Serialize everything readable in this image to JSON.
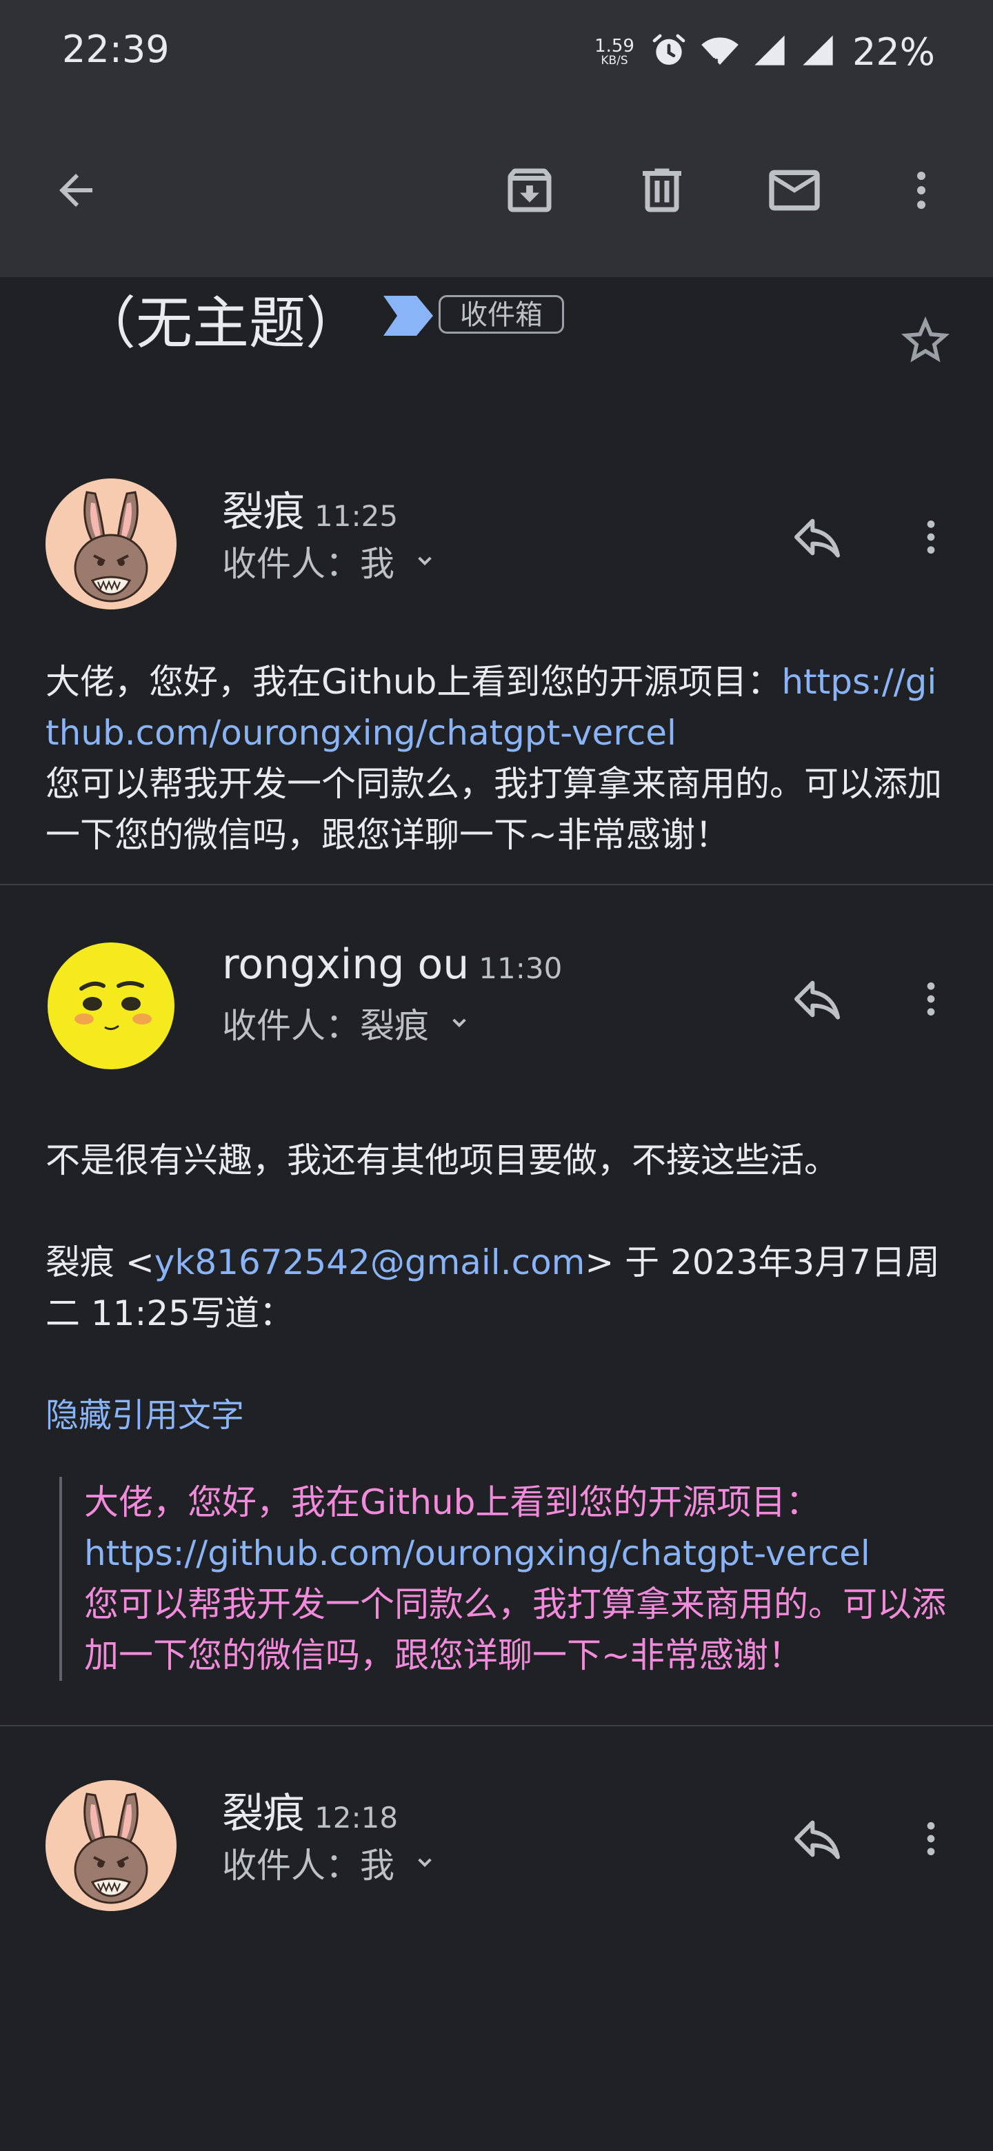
{
  "status": {
    "time": "22:39",
    "speed_value": "1.59",
    "speed_unit": "KB/S",
    "battery": "22%"
  },
  "toolbar": {
    "back": "back-arrow-icon",
    "archive": "archive-icon",
    "delete": "delete-icon",
    "mark_unread": "mail-icon",
    "more": "more-vert-icon"
  },
  "subject": {
    "title": "（无主题）",
    "label": "收件箱"
  },
  "messages": [
    {
      "sender": "裂痕",
      "time": "11:25",
      "recipient_prefix": "收件人：",
      "recipient": "我",
      "body_line1": "大佬，您好，我在Github上看到您的开源项目：",
      "body_link": "https://github.com/ourongxing/chatgpt-vercel",
      "body_line2": "您可以帮我开发一个同款么，我打算拿来商用的。可以添加一下您的微信吗，跟您详聊一下~非常感谢！"
    },
    {
      "sender": "rongxing ou",
      "time": "11:30",
      "recipient_prefix": "收件人：",
      "recipient": "裂痕",
      "body_line1": "不是很有兴趣，我还有其他项目要做，不接这些活。",
      "quote_author": "裂痕 <",
      "quote_email": "yk81672542@gmail.com",
      "quote_header_rest": "> 于 2023年3月7日周二 11:25写道：",
      "hide_quoted": "隐藏引用文字",
      "quote_line1": "大佬，您好，我在Github上看到您的开源项目：",
      "quote_link": "https://github.com/ourongxing/chatgpt-vercel",
      "quote_line2": "您可以帮我开发一个同款么，我打算拿来商用的。可以添加一下您的微信吗，跟您详聊一下~非常感谢！"
    },
    {
      "sender": "裂痕",
      "time": "12:18",
      "recipient_prefix": "收件人：",
      "recipient": "我"
    }
  ],
  "colors": {
    "background": "#202124",
    "bar": "#303134",
    "link": "#8ab4f8",
    "quote_text": "#f28bdb",
    "label_arrow": "#8ab4f8"
  }
}
